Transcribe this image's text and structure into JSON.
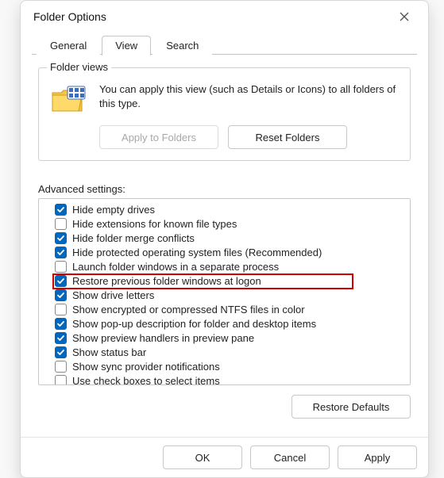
{
  "title": "Folder Options",
  "tabs": {
    "general": "General",
    "view": "View",
    "search": "Search",
    "active": "view"
  },
  "folder_views": {
    "legend": "Folder views",
    "text": "You can apply this view (such as Details or Icons) to all folders of this type.",
    "apply_btn": "Apply to Folders",
    "reset_btn": "Reset Folders",
    "apply_disabled": true
  },
  "advanced": {
    "label": "Advanced settings:",
    "items": [
      {
        "label": "Hide empty drives",
        "checked": true
      },
      {
        "label": "Hide extensions for known file types",
        "checked": false
      },
      {
        "label": "Hide folder merge conflicts",
        "checked": true
      },
      {
        "label": "Hide protected operating system files (Recommended)",
        "checked": true
      },
      {
        "label": "Launch folder windows in a separate process",
        "checked": false
      },
      {
        "label": "Restore previous folder windows at logon",
        "checked": true,
        "highlight": true
      },
      {
        "label": "Show drive letters",
        "checked": true
      },
      {
        "label": "Show encrypted or compressed NTFS files in color",
        "checked": false
      },
      {
        "label": "Show pop-up description for folder and desktop items",
        "checked": true
      },
      {
        "label": "Show preview handlers in preview pane",
        "checked": true
      },
      {
        "label": "Show status bar",
        "checked": true
      },
      {
        "label": "Show sync provider notifications",
        "checked": false
      },
      {
        "label": "Use check boxes to select items",
        "checked": false
      }
    ],
    "restore_defaults": "Restore Defaults"
  },
  "footer": {
    "ok": "OK",
    "cancel": "Cancel",
    "apply": "Apply"
  },
  "colors": {
    "accent": "#0067c0",
    "highlight_border": "#d30000"
  }
}
